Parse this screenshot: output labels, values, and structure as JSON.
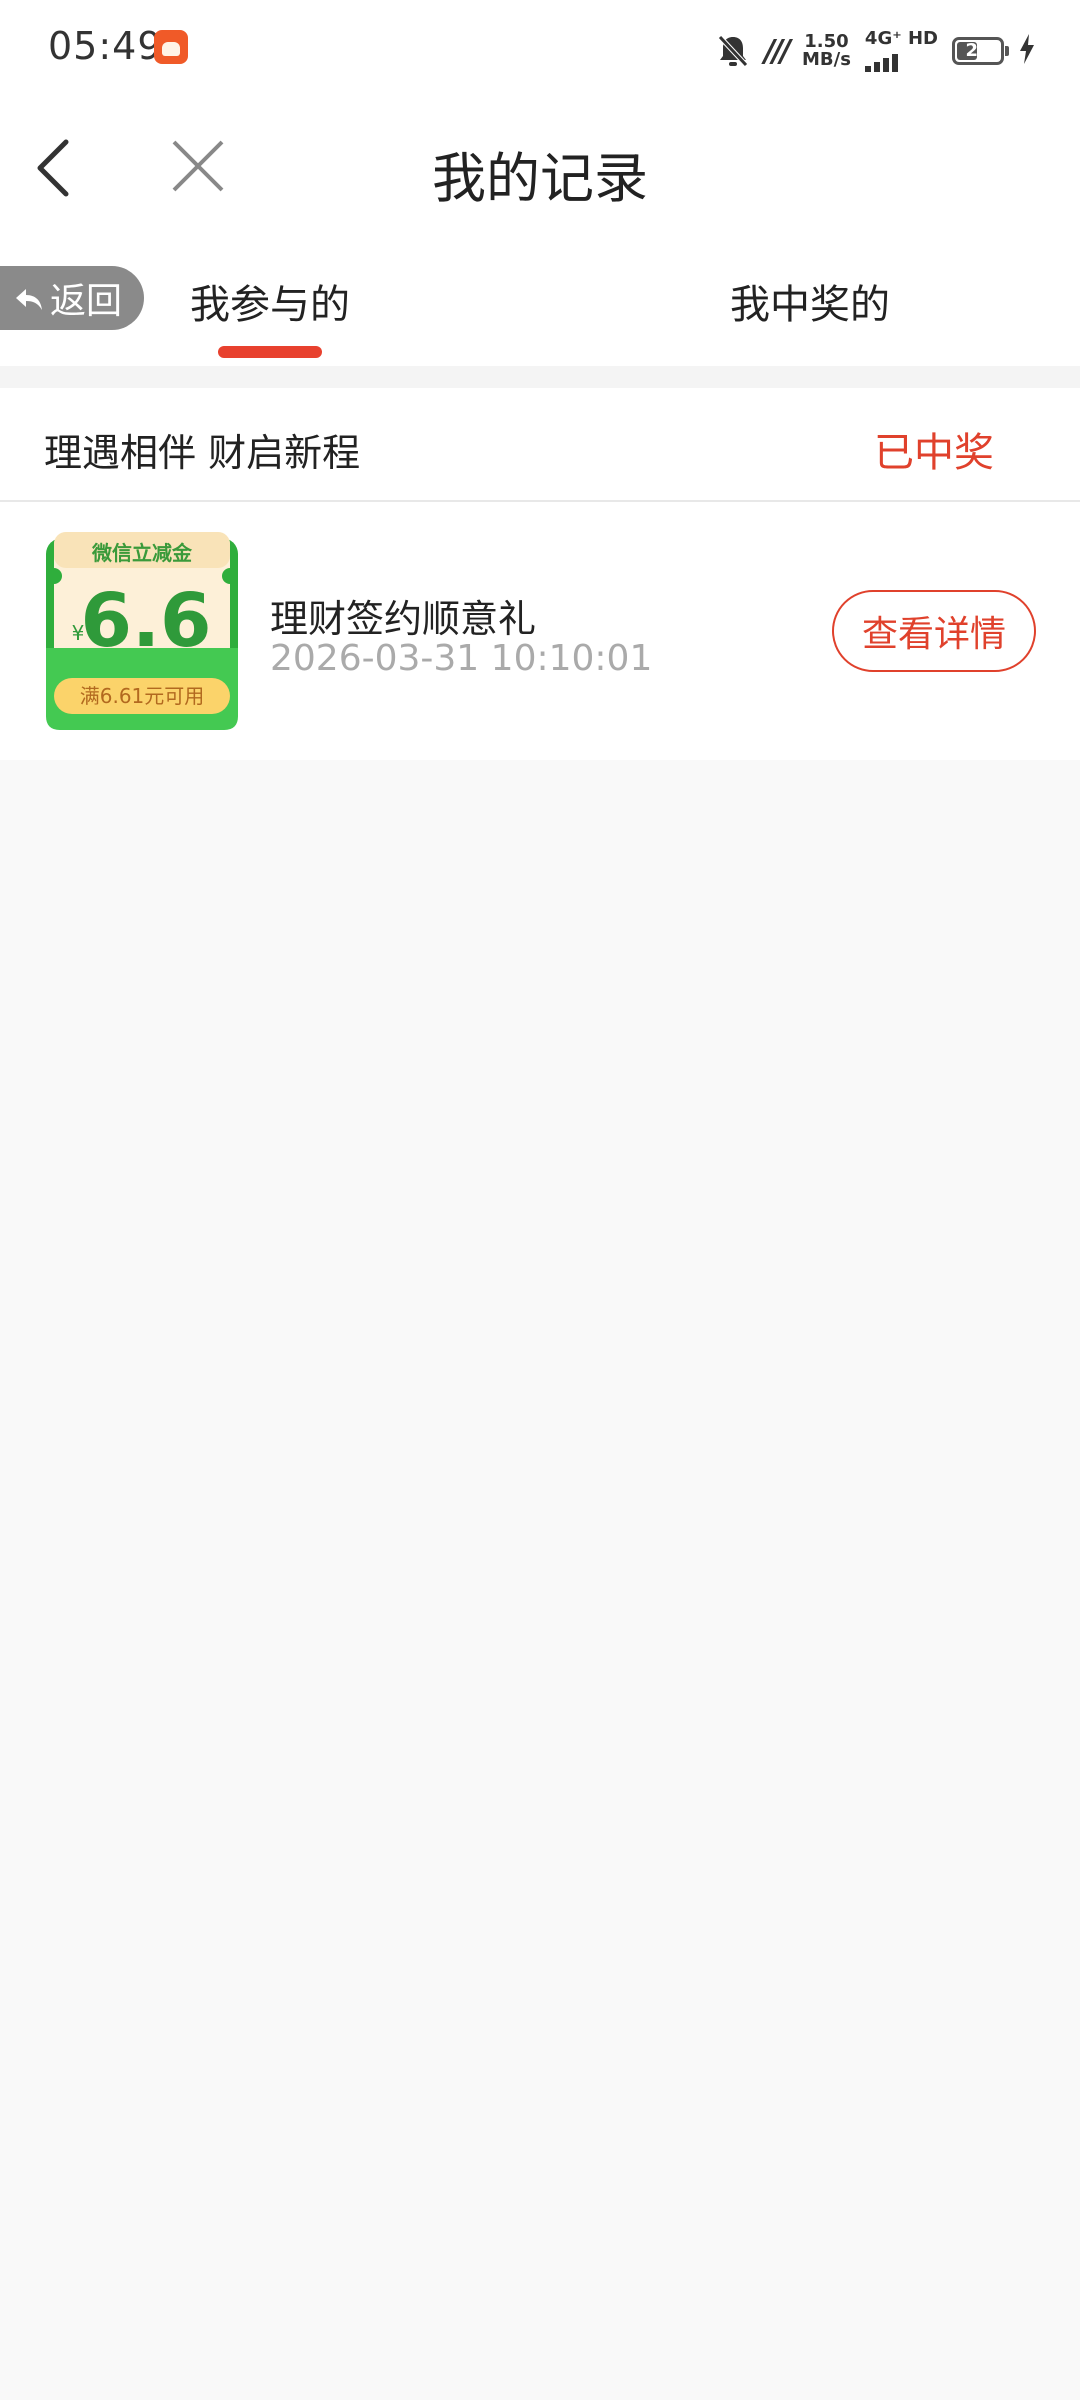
{
  "status_bar": {
    "time": "05:49",
    "speed_value": "1.50",
    "speed_unit": "MB/s",
    "network_type": "4G⁺ HD",
    "battery_level": "27"
  },
  "nav": {
    "title": "我的记录"
  },
  "tabs": {
    "return_label": "返回",
    "items": [
      {
        "label": "我参与的",
        "active": true
      },
      {
        "label": "我中奖的",
        "active": false
      }
    ]
  },
  "campaign": {
    "name": "理遇相伴 财启新程",
    "status": "已中奖"
  },
  "record": {
    "voucher": {
      "header": "微信立减金",
      "currency": "¥",
      "amount": "6.6",
      "condition": "满6.61元可用"
    },
    "title": "理财签约顺意礼",
    "time": "2026-03-31 10:10:01",
    "detail_label": "查看详情"
  },
  "colors": {
    "accent": "#e0412c",
    "voucher_green": "#3cc14a",
    "voucher_cream": "#fdf0d8"
  }
}
